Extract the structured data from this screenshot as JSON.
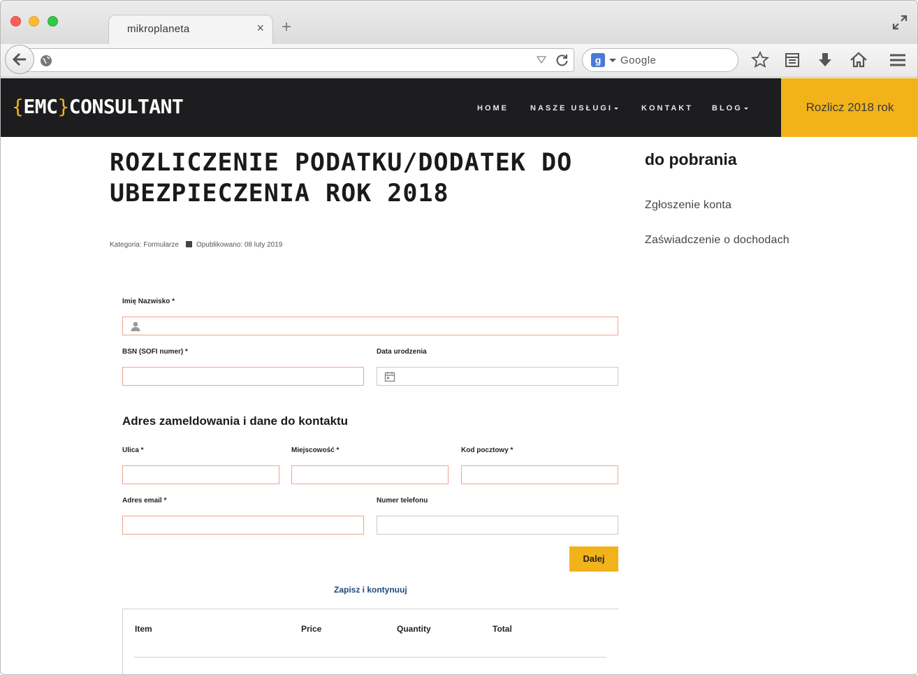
{
  "browser": {
    "tab_title": "mikroplaneta",
    "tab_close": "×",
    "new_tab": "+",
    "search_placeholder": "Google",
    "search_engine_letter": "g"
  },
  "site": {
    "logo": {
      "open": "{",
      "brand": "EMC",
      "close": "}",
      "rest": "CONSULTANT"
    },
    "nav": [
      {
        "label": "HOME"
      },
      {
        "label": "NASZE USŁUGI"
      },
      {
        "label": "KONTAKT"
      },
      {
        "label": "BLOG"
      }
    ],
    "cta_label": "Rozlicz 2018 rok"
  },
  "article": {
    "title_line1": "ROZLICZENIE PODATKU/DODATEK DO",
    "title_line2": "UBEZPIECZENIA ROK 2018",
    "category": "Kategoria: Formularze",
    "published": "Opublikowano: 08 luty 2019"
  },
  "form": {
    "name_label": "Imię Nazwisko *",
    "bsn_label": "BSN (SOFI numer) *",
    "dob_label": "Data urodzenia",
    "address_heading": "Adres zameldowania i dane do kontaktu",
    "street_label": "Ulica *",
    "city_label": "Miejscowość *",
    "zip_label": "Kod pocztowy *",
    "email_label": "Adres email *",
    "phone_label": "Numer telefonu",
    "next_button": "Dalej",
    "save_link": "Zapisz i kontynuuj",
    "table_headers": [
      "Item",
      "Price",
      "Quantity",
      "Total"
    ]
  },
  "sidebar": {
    "title": "do pobrania",
    "links": [
      "Zgłoszenie konta",
      "Zaświadczenie o dochodach"
    ]
  },
  "colors": {
    "accent": "#f1b21a",
    "header_bg": "#1d1c1e",
    "required_border": "#f0a490",
    "link": "#1d4a7a"
  }
}
